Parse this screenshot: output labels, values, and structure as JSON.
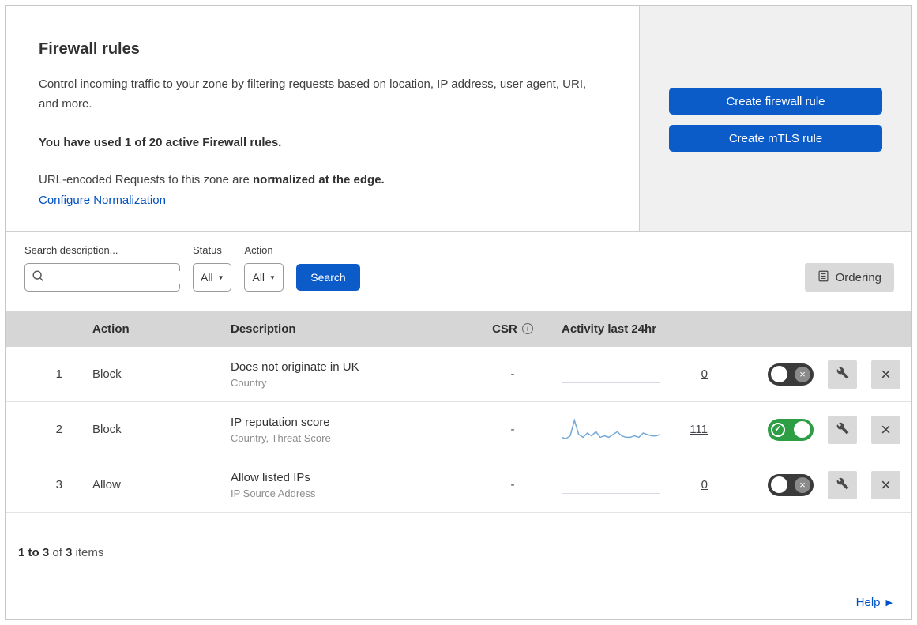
{
  "header": {
    "title": "Firewall rules",
    "description": "Control incoming traffic to your zone by filtering requests based on location, IP address, user agent, URI, and more.",
    "usage_notice": "You have used 1 of 20 active Firewall rules.",
    "normalization_prefix": "URL-encoded Requests to this zone are ",
    "normalization_bold": "normalized at the edge.",
    "normalization_link": "Configure Normalization",
    "buttons": {
      "create_firewall_rule": "Create firewall rule",
      "create_mtls_rule": "Create mTLS rule"
    }
  },
  "filters": {
    "search_label": "Search description...",
    "status_label": "Status",
    "status_value": "All",
    "action_label": "Action",
    "action_value": "All",
    "search_button": "Search",
    "ordering_button": "Ordering"
  },
  "table": {
    "headers": {
      "action": "Action",
      "description": "Description",
      "csr": "CSR",
      "activity": "Activity last 24hr"
    },
    "rows": [
      {
        "index": "1",
        "action": "Block",
        "description": "Does not originate in UK",
        "subtitle": "Country",
        "csr": "-",
        "count": "0",
        "enabled": false
      },
      {
        "index": "2",
        "action": "Block",
        "description": "IP reputation score",
        "subtitle": "Country, Threat Score",
        "csr": "-",
        "count": "111",
        "enabled": true
      },
      {
        "index": "3",
        "action": "Allow",
        "description": "Allow listed IPs",
        "subtitle": "IP Source Address",
        "csr": "-",
        "count": "0",
        "enabled": false
      }
    ],
    "footer": {
      "range": "1 to 3",
      "of_text": " of ",
      "total": "3",
      "items_text": " items"
    }
  },
  "help_link": "Help",
  "chart_data": {
    "type": "line",
    "title": "Activity last 24hr sparkline (rule 2: IP reputation score)",
    "x_range_hours": 24,
    "series": [
      {
        "name": "rule-2-activity",
        "values": [
          2,
          1,
          3,
          14,
          4,
          2,
          5,
          3,
          6,
          2,
          3,
          2,
          4,
          6,
          3,
          2,
          2,
          3,
          2,
          5,
          4,
          3,
          3,
          4
        ]
      }
    ],
    "total": 111
  },
  "colors": {
    "primary_blue": "#0b5bc9",
    "link_blue": "#0051c3",
    "toggle_green": "#2e9e44",
    "toggle_off_dark": "#3a3a3a",
    "table_header_gray": "#d6d6d6",
    "panel_gray": "#f0f0f0",
    "button_gray": "#d9d9d9",
    "sparkline_blue": "#74a9d8"
  }
}
